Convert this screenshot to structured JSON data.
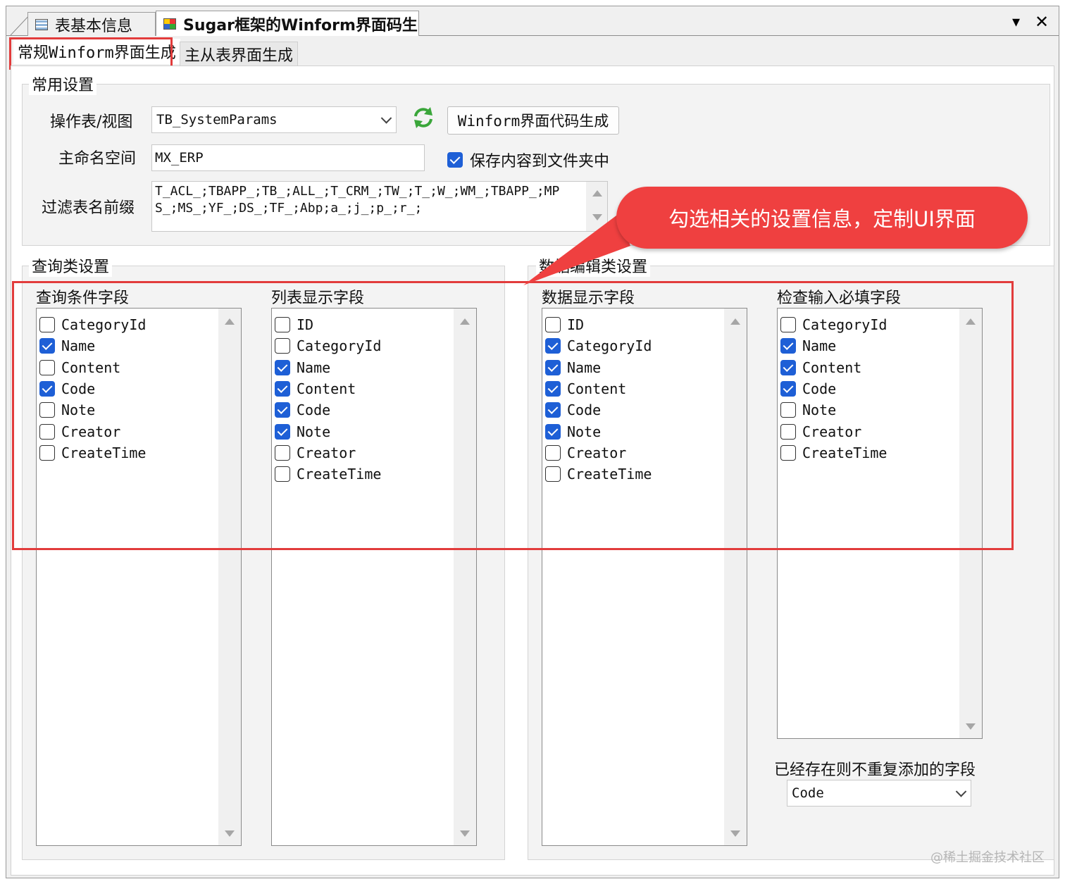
{
  "doc_tabs": [
    {
      "label": "表基本信息"
    },
    {
      "label": "Sugar框架的Winform界面码生"
    }
  ],
  "tab_controls": {
    "dropdown": "▾",
    "close": "✕"
  },
  "inner_tabs": [
    {
      "label": "常规Winform界面生成",
      "active": true
    },
    {
      "label": "主从表界面生成",
      "active": false
    }
  ],
  "common": {
    "title": "常用设置",
    "table_label": "操作表/视图",
    "table_value": "TB_SystemParams",
    "generate_button": "Winform界面代码生成",
    "namespace_label": "主命名空间",
    "namespace_value": "MX_ERP",
    "save_to_folder_label": "保存内容到文件夹中",
    "save_to_folder_checked": true,
    "prefix_label": "过滤表名前缀",
    "prefix_line1": "T_ACL_;TBAPP_;TB_;ALL_;T_CRM_;TW_;T_;W_;WM_;TBAPP_;MP",
    "prefix_line2": "S_;MS_;YF_;DS_;TF_;Abp;a_;j_;p_;r_;"
  },
  "query_group": {
    "title": "查询类设置",
    "condition_title": "查询条件字段",
    "condition_fields": [
      {
        "name": "CategoryId",
        "checked": false
      },
      {
        "name": "Name",
        "checked": true
      },
      {
        "name": "Content",
        "checked": false
      },
      {
        "name": "Code",
        "checked": true
      },
      {
        "name": "Note",
        "checked": false
      },
      {
        "name": "Creator",
        "checked": false
      },
      {
        "name": "CreateTime",
        "checked": false
      }
    ],
    "list_title": "列表显示字段",
    "list_fields": [
      {
        "name": "ID",
        "checked": false
      },
      {
        "name": "CategoryId",
        "checked": false
      },
      {
        "name": "Name",
        "checked": true
      },
      {
        "name": "Content",
        "checked": true
      },
      {
        "name": "Code",
        "checked": true
      },
      {
        "name": "Note",
        "checked": true
      },
      {
        "name": "Creator",
        "checked": false
      },
      {
        "name": "CreateTime",
        "checked": false
      }
    ]
  },
  "edit_group": {
    "title": "数据编辑类设置",
    "display_title": "数据显示字段",
    "display_fields": [
      {
        "name": "ID",
        "checked": false
      },
      {
        "name": "CategoryId",
        "checked": true
      },
      {
        "name": "Name",
        "checked": true
      },
      {
        "name": "Content",
        "checked": true
      },
      {
        "name": "Code",
        "checked": true
      },
      {
        "name": "Note",
        "checked": true
      },
      {
        "name": "Creator",
        "checked": false
      },
      {
        "name": "CreateTime",
        "checked": false
      }
    ],
    "required_title": "检查输入必填字段",
    "required_fields": [
      {
        "name": "CategoryId",
        "checked": false
      },
      {
        "name": "Name",
        "checked": true
      },
      {
        "name": "Content",
        "checked": true
      },
      {
        "name": "Code",
        "checked": true
      },
      {
        "name": "Note",
        "checked": false
      },
      {
        "name": "Creator",
        "checked": false
      },
      {
        "name": "CreateTime",
        "checked": false
      }
    ],
    "unique_label": "已经存在则不重复添加的字段",
    "unique_value": "Code"
  },
  "callout": {
    "text": "勾选相关的设置信息，定制UI界面"
  },
  "watermark": "@稀土掘金技术社区",
  "icons": {
    "refresh": "refresh-icon",
    "table": "table-icon",
    "form": "form-icon"
  },
  "colors": {
    "accent": "#1e5fd6",
    "highlight": "#e23c3c",
    "callout": "#ef4040"
  }
}
